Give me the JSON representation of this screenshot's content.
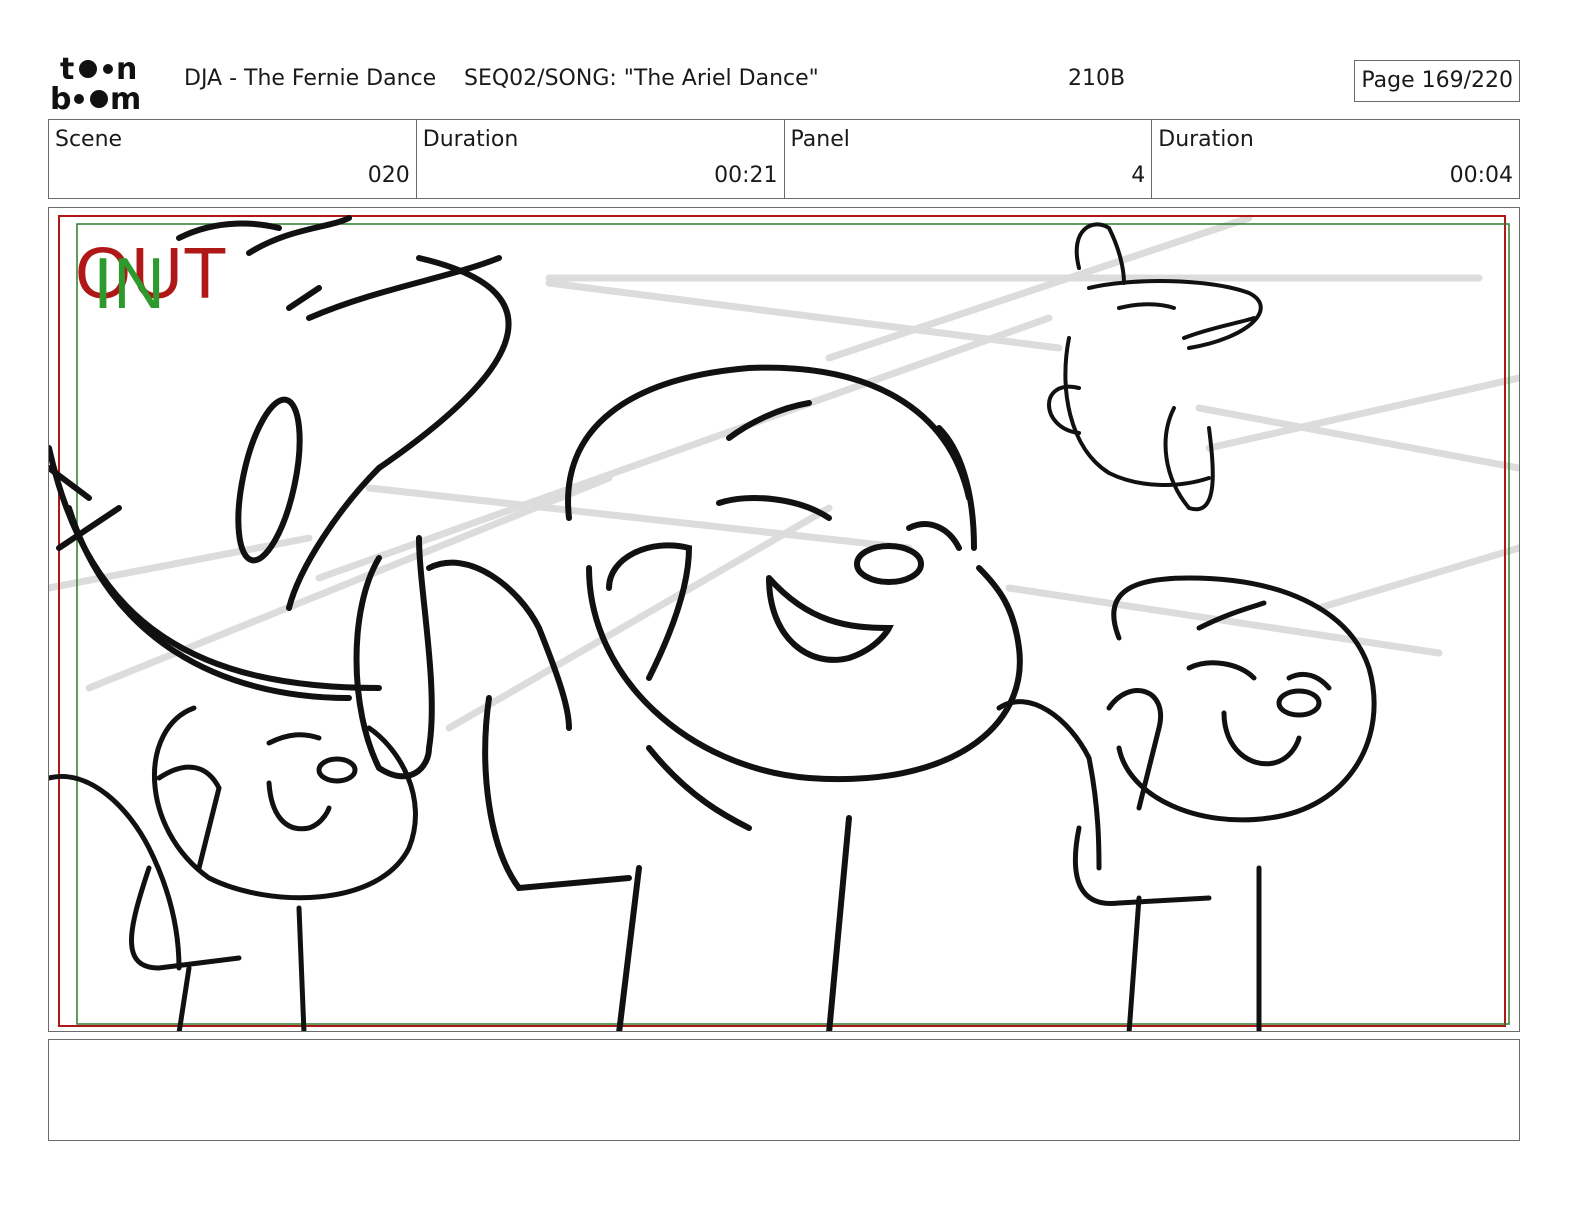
{
  "header": {
    "logo_text_top": "toon",
    "logo_text_bottom": "boom",
    "project": "DJA - The Fernie Dance",
    "sequence": "SEQ02/SONG: \"The Ariel Dance\"",
    "code": "210B",
    "page": "Page 169/220"
  },
  "info": {
    "scene_label": "Scene",
    "scene_value": "020",
    "scene_duration_label": "Duration",
    "scene_duration_value": "00:21",
    "panel_label": "Panel",
    "panel_value": "4",
    "panel_duration_label": "Duration",
    "panel_duration_value": "00:04"
  },
  "panel_marks": {
    "out_label": "OUT",
    "in_label": "IN",
    "out_color": "#b01818",
    "in_color": "#2c9a2c"
  },
  "notes": {
    "text": ""
  }
}
